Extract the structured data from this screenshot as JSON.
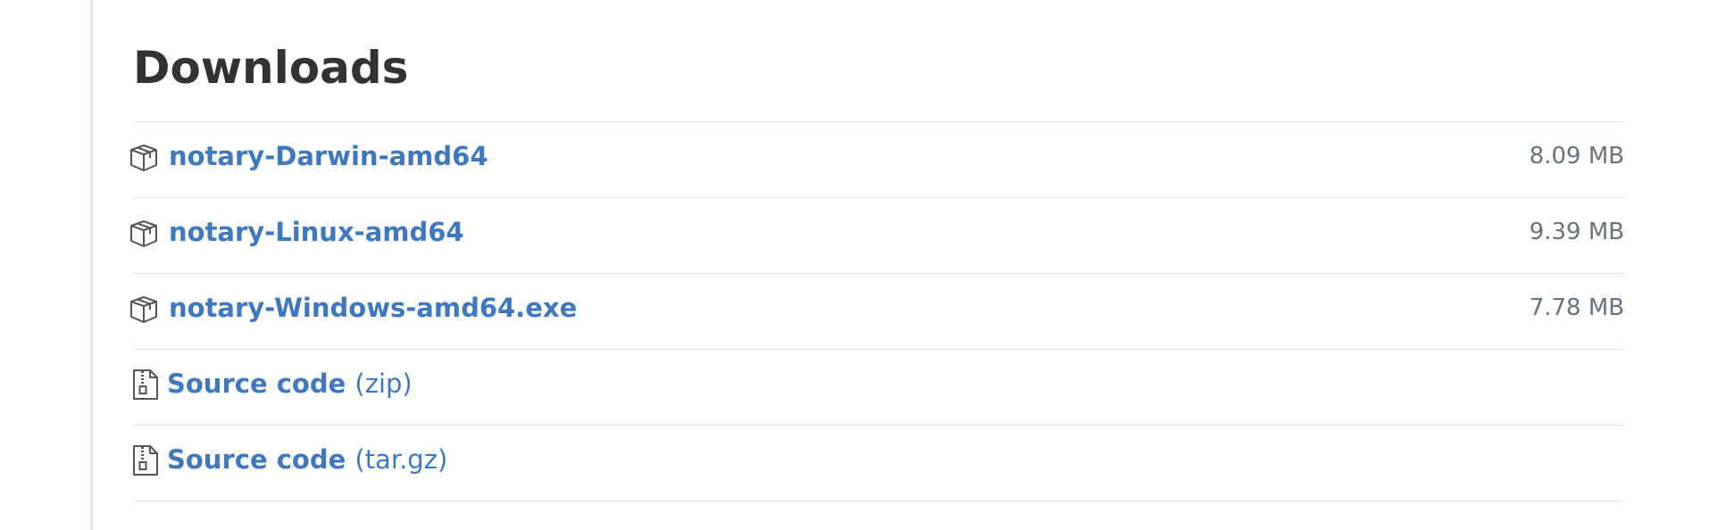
{
  "downloads": {
    "title": "Downloads",
    "assets": [
      {
        "name": "notary-Darwin-amd64",
        "size": "8.09 MB",
        "icon": "package-icon"
      },
      {
        "name": "notary-Linux-amd64",
        "size": "9.39 MB",
        "icon": "package-icon"
      },
      {
        "name": "notary-Windows-amd64.exe",
        "size": "7.78 MB",
        "icon": "package-icon"
      }
    ],
    "source": [
      {
        "label": "Source code",
        "suffix": "(zip)",
        "icon": "file-zip-icon"
      },
      {
        "label": "Source code",
        "suffix": "(tar.gz)",
        "icon": "file-zip-icon"
      }
    ]
  },
  "colors": {
    "link": "#4078c0",
    "heading": "#333333",
    "muted": "#6a737d",
    "divider": "#e1e4e8"
  }
}
